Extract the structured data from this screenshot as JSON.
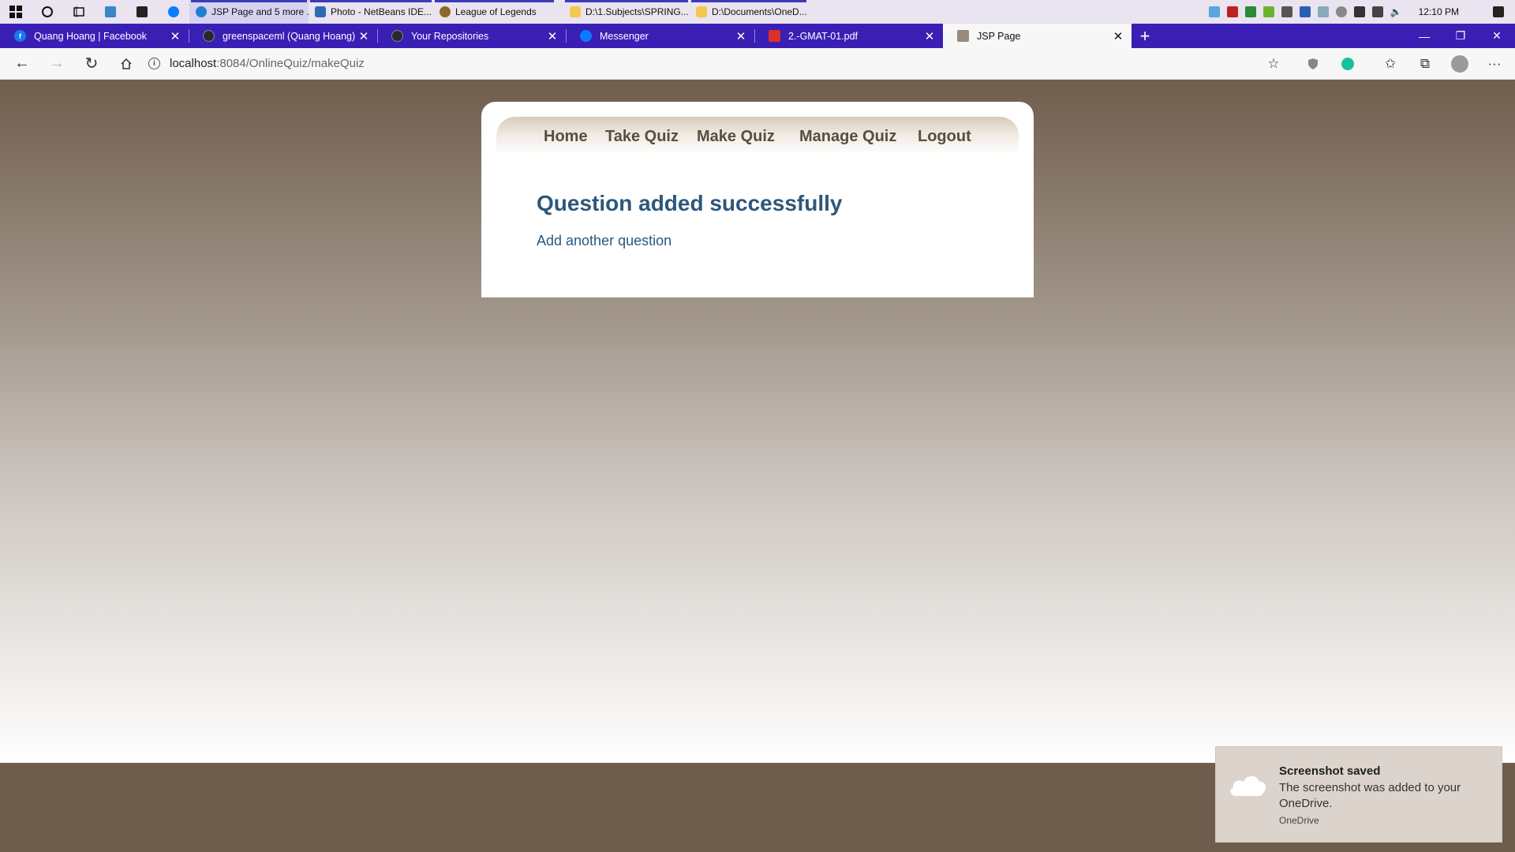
{
  "taskbar": {
    "apps": [
      {
        "label": "JSP Page and 5 more ...",
        "icon": "edge-icon",
        "color": "#1f7fd0",
        "active": true
      },
      {
        "label": "Photo - NetBeans IDE...",
        "icon": "netbeans-icon",
        "color": "#2d6bb3",
        "active": false
      },
      {
        "label": "League of Legends",
        "icon": "league-icon",
        "color": "#8a6a2a",
        "active": false
      },
      {
        "label": "D:\\1.Subjects\\SPRING...",
        "icon": "folder-icon",
        "color": "#f2c94c",
        "active": false
      },
      {
        "label": "D:\\Documents\\OneD...",
        "icon": "folder-icon",
        "color": "#f2c94c",
        "active": false
      }
    ],
    "clock": "12:10 PM"
  },
  "tabs": [
    {
      "title": "Quang Hoang | Facebook",
      "icon": "facebook-icon",
      "color": "#1877f2",
      "glyph": "f"
    },
    {
      "title": "greenspaceml (Quang Hoang)",
      "icon": "github-icon",
      "color": "#24292e",
      "glyph": ""
    },
    {
      "title": "Your Repositories",
      "icon": "github-icon",
      "color": "#24292e",
      "glyph": ""
    },
    {
      "title": "Messenger",
      "icon": "messenger-icon",
      "color": "#0a7cff",
      "glyph": ""
    },
    {
      "title": "2.-GMAT-01.pdf",
      "icon": "pdf-icon",
      "color": "#d9302a",
      "glyph": ""
    },
    {
      "title": "JSP Page",
      "icon": "page-icon",
      "color": "#9a8c7c",
      "glyph": ""
    }
  ],
  "address": {
    "host": "localhost",
    "path": ":8084/OnlineQuiz/makeQuiz"
  },
  "menu": {
    "home": "Home",
    "take_quiz": "Take Quiz",
    "make_quiz": "Make Quiz",
    "manage_quiz": "Manage Quiz",
    "logout": "Logout"
  },
  "content": {
    "heading": "Question added successfully",
    "link": "Add another question"
  },
  "toast": {
    "title": "Screenshot saved",
    "body": "The screenshot was added to your OneDrive.",
    "source": "OneDrive"
  },
  "colors": {
    "accent": "#3a1fb5",
    "heading": "#2c577c",
    "menu_text": "#5a4d3f",
    "page_dark": "#6f5e4d"
  }
}
